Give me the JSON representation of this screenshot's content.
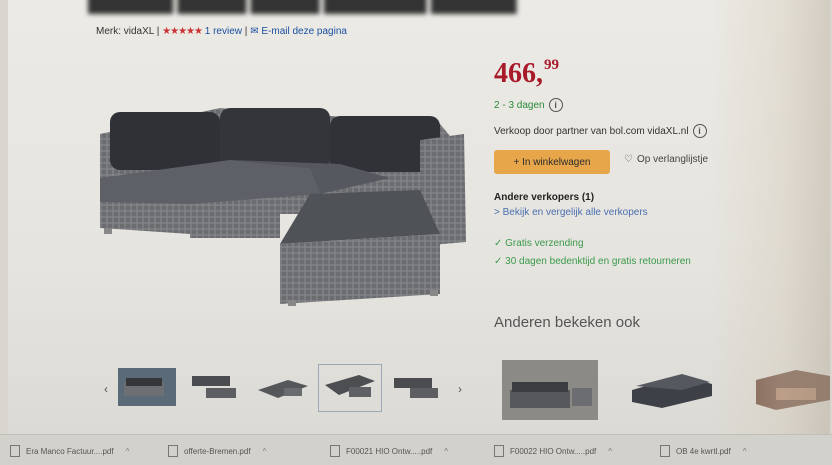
{
  "product": {
    "brand_label": "Merk: vidaXL",
    "rating_stars": "★★★★★",
    "review_count": "1 review",
    "email_link": "E-mail deze pagina"
  },
  "offer": {
    "price_main": "466,",
    "price_cents": "99",
    "delivery": "2 - 3 dagen",
    "seller": "Verkoop door partner van bol.com vidaXL.nl",
    "add_to_cart": "+ In winkelwagen",
    "wishlist": "Op verlanglijstje",
    "other_sellers": "Andere verkopers (1)",
    "compare_sellers": "> Bekijk en vergelijk alle verkopers",
    "usp_shipping": "✓ Gratis verzending",
    "usp_return": "✓ 30 dagen bedenktijd en gratis retourneren"
  },
  "recommendations": {
    "heading": "Anderen bekeken ook"
  },
  "downloads": [
    {
      "name": "Era Manco Factuur....pdf"
    },
    {
      "name": "offerte-Bremen.pdf"
    },
    {
      "name": "F00021 HIO Ontw.....pdf"
    },
    {
      "name": "F00022 HIO Ontw.....pdf"
    },
    {
      "name": "OB 4e kwrtl.pdf"
    }
  ],
  "colors": {
    "price": "#a8192a",
    "cart_button": "#e7a64a",
    "usp_green": "#3a9a4c",
    "link_blue": "#4a6fb0"
  }
}
